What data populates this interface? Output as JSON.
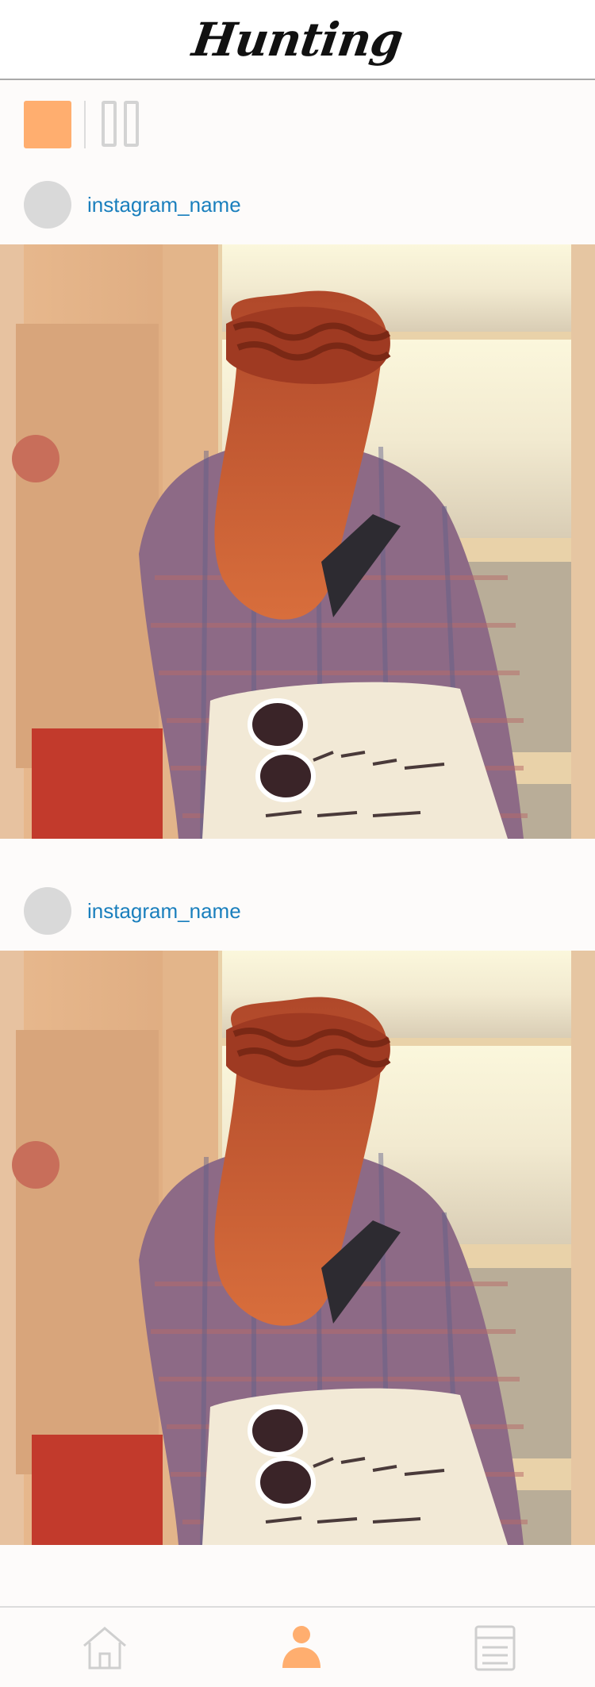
{
  "header": {
    "title": "Hunting"
  },
  "view_toggle": {
    "active": "single"
  },
  "posts": [
    {
      "username": "instagram_name",
      "photo": "Woman with braided red hair in plaid shirt carrying a tote bag with heart sunglasses, looking out a window"
    },
    {
      "username": "instagram_name",
      "photo": "Woman with braided red hair in plaid shirt carrying a tote bag with heart sunglasses, looking out a window"
    }
  ],
  "bottom_nav": {
    "items": [
      {
        "icon": "home-icon",
        "active": false
      },
      {
        "icon": "profile-icon",
        "active": true
      },
      {
        "icon": "list-icon",
        "active": false
      }
    ]
  },
  "colors": {
    "accent": "#ffae6f",
    "username": "#1a7fbd",
    "inactive_icon": "#cfcfcf"
  }
}
